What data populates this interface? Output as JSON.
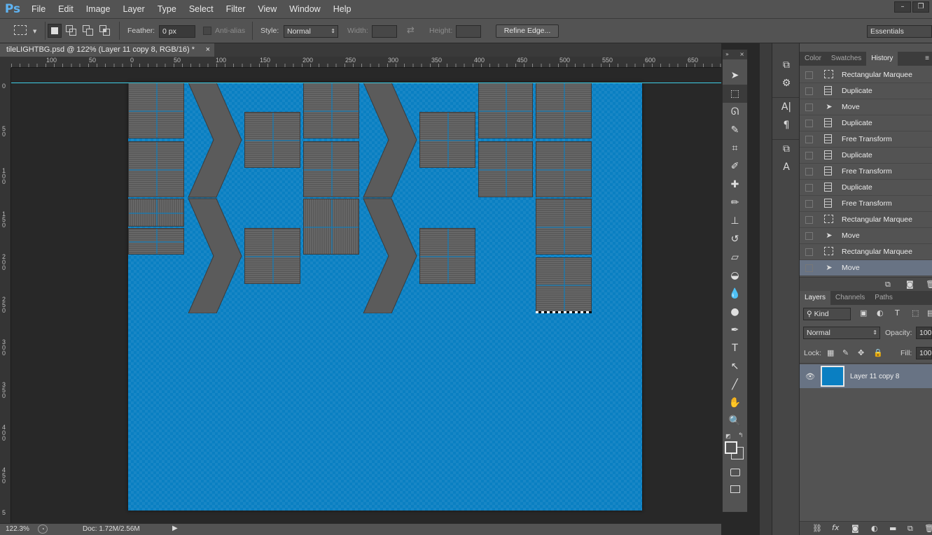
{
  "app": {
    "logo": "Ps",
    "menu": [
      "File",
      "Edit",
      "Image",
      "Layer",
      "Type",
      "Select",
      "Filter",
      "View",
      "Window",
      "Help"
    ],
    "window_buttons": [
      "–",
      "❐"
    ]
  },
  "options_bar": {
    "feather_label": "Feather:",
    "feather_value": "0 px",
    "antialias_label": "Anti-alias",
    "style_label": "Style:",
    "style_value": "Normal",
    "width_label": "Width:",
    "height_label": "Height:",
    "refine_edge": "Refine Edge...",
    "workspace": "Essentials"
  },
  "document": {
    "tab_title": "tileLIGHTBG.psd @ 122% (Layer 11 copy 8, RGB/16) *",
    "close": "×",
    "ruler_h": [
      "100",
      "50",
      "0",
      "50",
      "100",
      "150",
      "200",
      "250",
      "300",
      "350",
      "400",
      "450",
      "500",
      "550",
      "600",
      "650"
    ],
    "ruler_v": [
      "0",
      "5\n0",
      "1\n0\n0",
      "1\n5\n0",
      "2\n0\n0",
      "2\n5\n0",
      "3\n0\n0",
      "3\n5\n0",
      "4\n0\n0",
      "4\n5\n0",
      "5"
    ],
    "canvas_color": "#0a7fc2",
    "guide_color": "#3fd0e8"
  },
  "status": {
    "zoom": "122.3%",
    "doc": "Doc: 1.72M/2.56M"
  },
  "toolbar": {
    "header": "»",
    "tools": [
      {
        "name": "move-tool",
        "glyph": "➤"
      },
      {
        "name": "rectangular-marquee-tool",
        "glyph": "⬚"
      },
      {
        "name": "lasso-tool",
        "glyph": "ᘏ"
      },
      {
        "name": "quick-selection-tool",
        "glyph": "✎"
      },
      {
        "name": "crop-tool",
        "glyph": "⌗"
      },
      {
        "name": "eyedropper-tool",
        "glyph": "✐"
      },
      {
        "name": "healing-brush-tool",
        "glyph": "✚"
      },
      {
        "name": "brush-tool",
        "glyph": "✏"
      },
      {
        "name": "clone-stamp-tool",
        "glyph": "⊥"
      },
      {
        "name": "history-brush-tool",
        "glyph": "↺"
      },
      {
        "name": "eraser-tool",
        "glyph": "▱"
      },
      {
        "name": "paint-bucket-tool",
        "glyph": "◒"
      },
      {
        "name": "blur-tool",
        "glyph": "💧"
      },
      {
        "name": "dodge-tool",
        "glyph": "●"
      },
      {
        "name": "pen-tool",
        "glyph": "✒"
      },
      {
        "name": "type-tool",
        "glyph": "T"
      },
      {
        "name": "path-selection-tool",
        "glyph": "↖"
      },
      {
        "name": "line-tool",
        "glyph": "╱"
      },
      {
        "name": "hand-tool",
        "glyph": "✋"
      },
      {
        "name": "zoom-tool",
        "glyph": "🔍"
      }
    ]
  },
  "panels": {
    "top_tabs": [
      "Color",
      "Swatches",
      "History"
    ],
    "history": [
      {
        "label": "Rectangular Marquee",
        "icon": "marquee"
      },
      {
        "label": "Duplicate",
        "icon": "doc"
      },
      {
        "label": "Move",
        "icon": "move"
      },
      {
        "label": "Duplicate",
        "icon": "doc"
      },
      {
        "label": "Free Transform",
        "icon": "doc"
      },
      {
        "label": "Duplicate",
        "icon": "doc"
      },
      {
        "label": "Free Transform",
        "icon": "doc"
      },
      {
        "label": "Duplicate",
        "icon": "doc"
      },
      {
        "label": "Free Transform",
        "icon": "doc"
      },
      {
        "label": "Rectangular Marquee",
        "icon": "marquee"
      },
      {
        "label": "Move",
        "icon": "move"
      },
      {
        "label": "Rectangular Marquee",
        "icon": "marquee"
      },
      {
        "label": "Move",
        "icon": "move"
      }
    ],
    "layer_tabs": [
      "Layers",
      "Channels",
      "Paths"
    ],
    "kind_label": "Kind",
    "blend_mode": "Normal",
    "opacity_label": "Opacity:",
    "opacity_value": "100%",
    "lock_label": "Lock:",
    "fill_label": "Fill:",
    "fill_value": "100%",
    "layer_name": "Layer 11 copy 8"
  }
}
